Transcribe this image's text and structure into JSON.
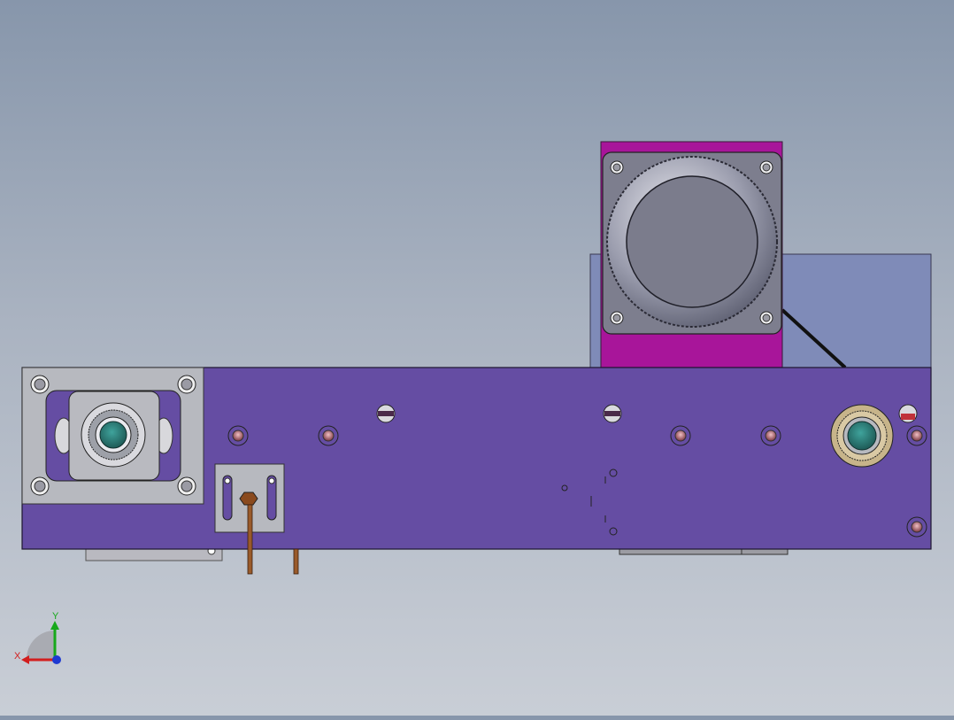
{
  "viewport": {
    "background_top": "#8796ab",
    "background_bottom": "#c9ced6"
  },
  "colors": {
    "plate": "#654da3",
    "motor_housing": "#a8159a",
    "back_panel": "#7f8bb8",
    "metal": "#b7b9bf",
    "bronze": "#c7b48a",
    "bearing_core": "#2f7f7a",
    "hole": "#c28a8e",
    "copper": "#9a5a2a"
  },
  "triad": {
    "x_label": "X",
    "y_label": "Y",
    "x_color": "#d21e1e",
    "y_color": "#17a81b",
    "z_color": "#1e3ad2"
  }
}
